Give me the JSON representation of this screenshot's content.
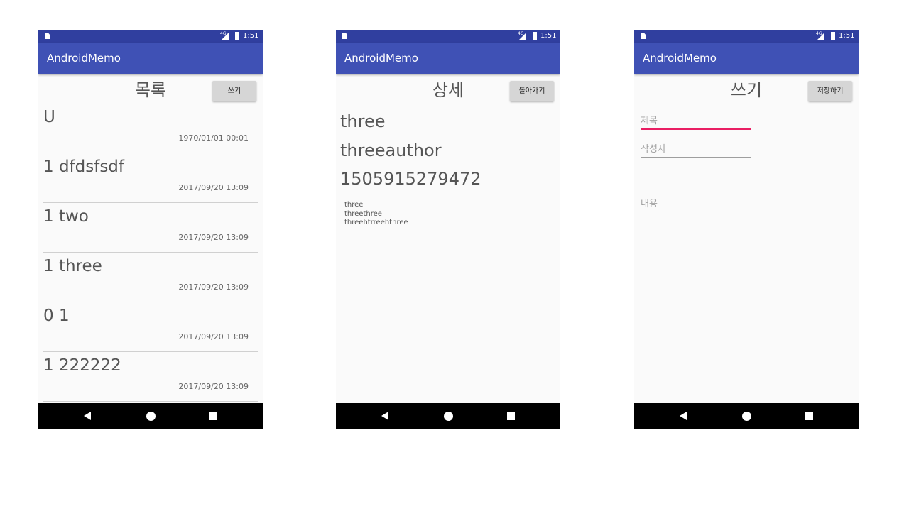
{
  "status": {
    "network": "4G",
    "time": "1:51"
  },
  "app": {
    "title": "AndroidMemo"
  },
  "list_screen": {
    "title": "목록",
    "write_button": "쓰기",
    "items": [
      {
        "title": "U",
        "date": "1970/01/01 00:01"
      },
      {
        "title": "1 dfdsfsdf",
        "date": "2017/09/20 13:09"
      },
      {
        "title": "1 two",
        "date": "2017/09/20 13:09"
      },
      {
        "title": "1 three",
        "date": "2017/09/20 13:09"
      },
      {
        "title": "0 1",
        "date": "2017/09/20 13:09"
      },
      {
        "title": "1 222222",
        "date": "2017/09/20 13:09"
      }
    ]
  },
  "detail_screen": {
    "title": "상세",
    "back_button": "돌아가기",
    "memo_title": "three",
    "author": "threeauthor",
    "timestamp": "1505915279472",
    "content": [
      "three",
      "threethree",
      "threehtrreehthree"
    ]
  },
  "write_screen": {
    "title": "쓰기",
    "save_button": "저장하기",
    "title_placeholder": "제목",
    "author_placeholder": "작성자",
    "content_placeholder": "내용"
  },
  "colors": {
    "status_bar": "#303f9f",
    "app_bar": "#3f51b5",
    "focus_underline": "#e91e63",
    "nav_bar": "#000000"
  },
  "icons": {
    "status": [
      "sim-card-icon",
      "signal-icon",
      "battery-charging-icon"
    ],
    "nav": [
      "back-icon",
      "home-icon",
      "recent-apps-icon"
    ]
  }
}
